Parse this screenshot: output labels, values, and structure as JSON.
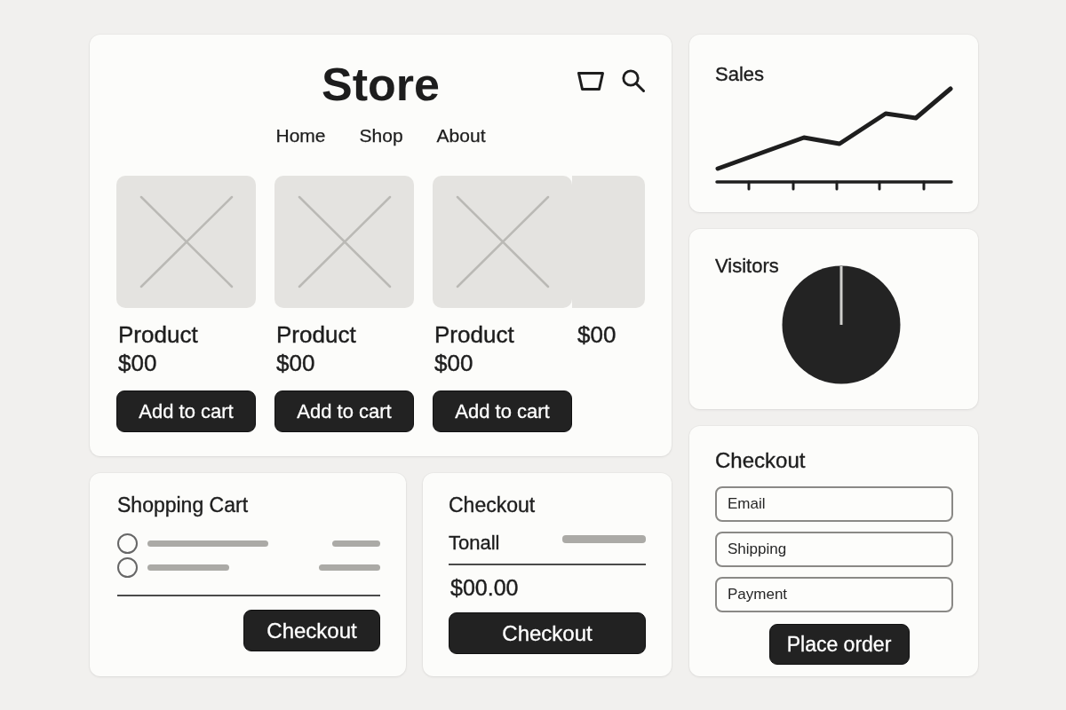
{
  "store": {
    "title": "Store",
    "nav": [
      "Home",
      "Shop",
      "About"
    ],
    "products": [
      {
        "kind": "full",
        "name": "Product",
        "price": "$00",
        "button": "Add to cart"
      },
      {
        "kind": "full",
        "name": "Product",
        "price": "$00",
        "button": "Add to cart"
      },
      {
        "kind": "full",
        "name": "Product",
        "price": "$00",
        "button": "Add to cart"
      },
      {
        "kind": "clipped",
        "price": "$00"
      }
    ]
  },
  "sales": {
    "title": "Sales"
  },
  "visitors": {
    "title": "Visitors"
  },
  "shopping_cart": {
    "title": "Shopping Cart",
    "items": [
      {
        "checked": false
      },
      {
        "checked": false
      }
    ],
    "button": "Checkout"
  },
  "order_summary": {
    "title": "Checkout",
    "label": "Tonall",
    "total": "$00.00",
    "button": "Checkout"
  },
  "checkout_form": {
    "title": "Checkout",
    "fields": [
      {
        "placeholder": "Email"
      },
      {
        "placeholder": "Shipping"
      },
      {
        "placeholder": "Payment"
      }
    ],
    "button": "Place order"
  }
}
